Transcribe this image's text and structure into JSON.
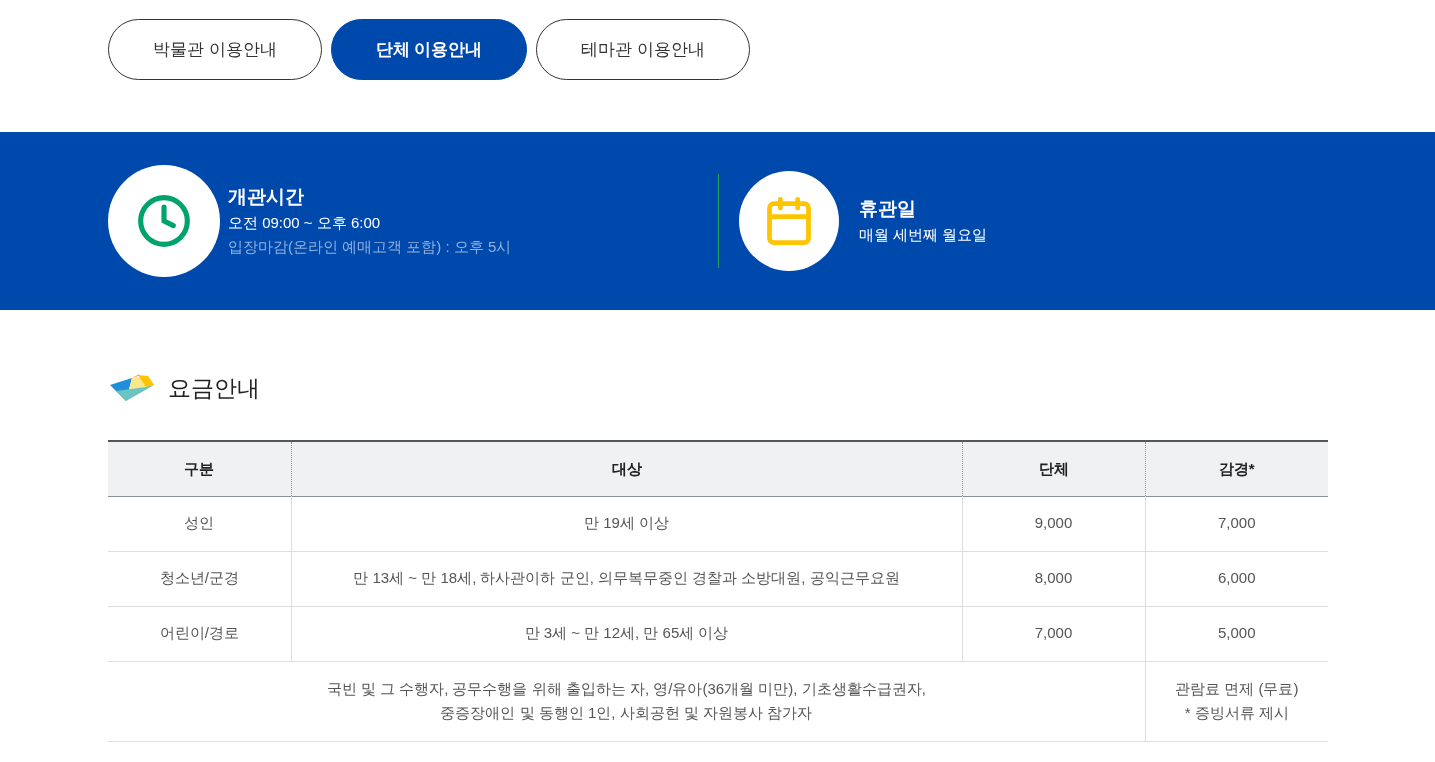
{
  "tabs": [
    {
      "label": "박물관 이용안내",
      "selected": false
    },
    {
      "label": "단체 이용안내",
      "selected": true
    },
    {
      "label": "테마관 이용안내",
      "selected": false
    }
  ],
  "info": {
    "hours": {
      "title": "개관시간",
      "time": "오전 09:00 ~ 오후 6:00",
      "note": "입장마감(온라인 예매고객 포함) : 오후 5시"
    },
    "closed": {
      "title": "휴관일",
      "text": "매월 세번째 월요일"
    }
  },
  "fees": {
    "title": "요금안내",
    "columns": [
      "구분",
      "대상",
      "단체",
      "감경*"
    ],
    "rows": [
      [
        "성인",
        "만 19세 이상",
        "9,000",
        "7,000"
      ],
      [
        "청소년/군경",
        "만 13세 ~ 만 18세, 하사관이하 군인, 의무복무중인 경찰과 소방대원, 공익근무요원",
        "8,000",
        "6,000"
      ],
      [
        "어린이/경로",
        "만 3세 ~ 만 12세, 만 65세 이상",
        "7,000",
        "5,000"
      ]
    ],
    "exempt": {
      "targets": [
        "국빈 및 그 수행자, 공무수행을 위해 출입하는 자, 영/유아(36개월 미만), 기초생활수급권자,",
        "중증장애인 및 동행인 1인, 사회공헌 및 자원봉사 참가자"
      ],
      "fee": [
        "관람료 면제 (무료)",
        "* 증빙서류 제시"
      ]
    }
  }
}
